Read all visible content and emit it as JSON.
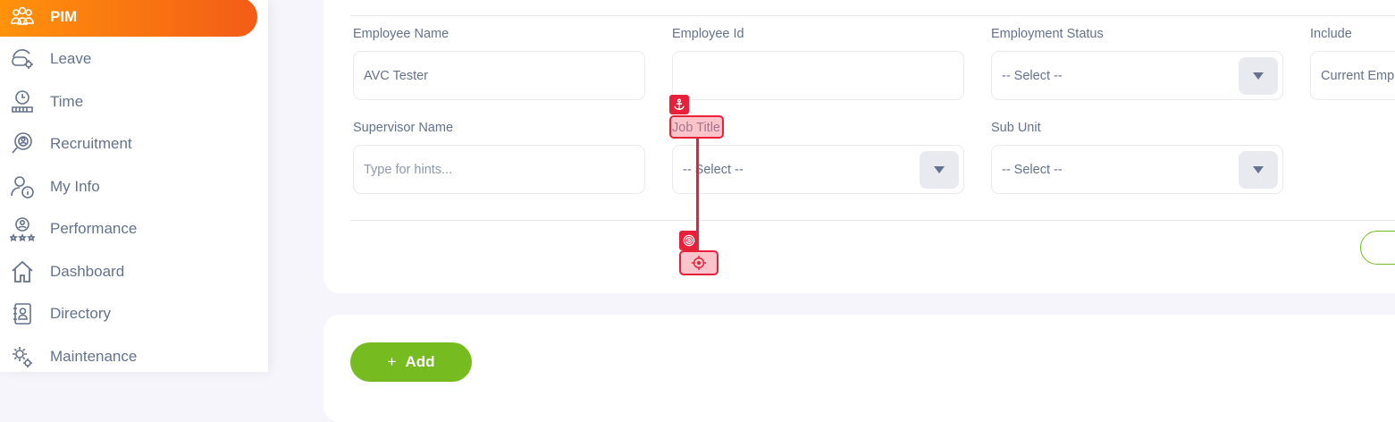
{
  "sidebar": {
    "items": [
      {
        "label": "PIM",
        "icon": "pim-icon",
        "active": true
      },
      {
        "label": "Leave",
        "icon": "leave-icon"
      },
      {
        "label": "Time",
        "icon": "time-icon"
      },
      {
        "label": "Recruitment",
        "icon": "recruitment-icon"
      },
      {
        "label": "My Info",
        "icon": "my-info-icon"
      },
      {
        "label": "Performance",
        "icon": "performance-icon"
      },
      {
        "label": "Dashboard",
        "icon": "dashboard-icon"
      },
      {
        "label": "Directory",
        "icon": "directory-icon"
      },
      {
        "label": "Maintenance",
        "icon": "maintenance-icon"
      }
    ]
  },
  "filters": {
    "employee_name": {
      "label": "Employee Name",
      "value": "AVC Tester"
    },
    "employee_id": {
      "label": "Employee Id",
      "value": ""
    },
    "employment_status": {
      "label": "Employment Status",
      "value": "-- Select --"
    },
    "include": {
      "label": "Include",
      "value": "Current Emp"
    },
    "supervisor_name": {
      "label": "Supervisor Name",
      "placeholder": "Type for hints..."
    },
    "job_title": {
      "label": "Job Title",
      "value": "-- Select --"
    },
    "sub_unit": {
      "label": "Sub Unit",
      "value": "-- Select --"
    }
  },
  "actions": {
    "add_label": "Add",
    "add_icon": "+"
  },
  "colors": {
    "brand_orange": "#ff920b",
    "brand_green": "#76bc21",
    "overlay_red": "#e8213a"
  }
}
